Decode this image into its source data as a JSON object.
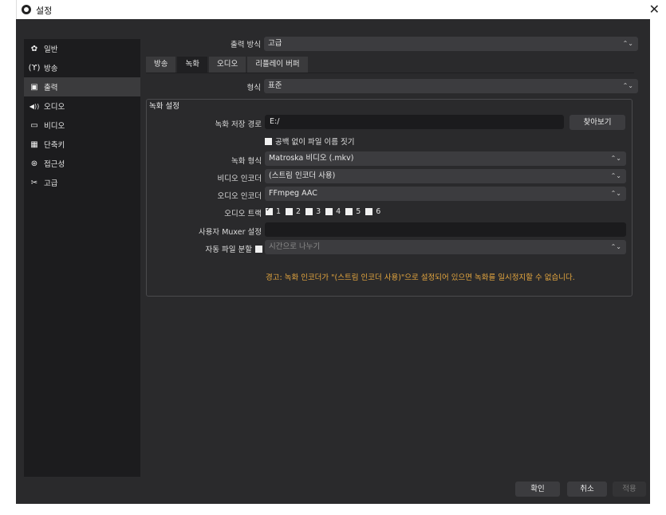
{
  "window": {
    "title": "설정",
    "close_glyph": "✕"
  },
  "sidebar": {
    "items": [
      {
        "label": "일반",
        "icon": "gear-icon",
        "glyph": "✿"
      },
      {
        "label": "방송",
        "icon": "broadcast-icon",
        "glyph": "(ϒ)"
      },
      {
        "label": "출력",
        "icon": "output-icon",
        "glyph": "▣"
      },
      {
        "label": "오디오",
        "icon": "speaker-icon",
        "glyph": "◀))"
      },
      {
        "label": "비디오",
        "icon": "monitor-icon",
        "glyph": "▭"
      },
      {
        "label": "단축키",
        "icon": "keyboard-icon",
        "glyph": "▦"
      },
      {
        "label": "접근성",
        "icon": "accessibility-icon",
        "glyph": "⊛"
      },
      {
        "label": "고급",
        "icon": "tools-icon",
        "glyph": "✂"
      }
    ],
    "active_index": 2
  },
  "output_mode": {
    "label": "출력 방식",
    "value": "고급"
  },
  "tabs": [
    "방송",
    "녹화",
    "오디오",
    "리플레이 버퍼"
  ],
  "active_tab_index": 1,
  "format": {
    "label": "형식",
    "value": "표준"
  },
  "recording": {
    "group_title": "녹화 설정",
    "path_label": "녹화 저장 경로",
    "path_value": "E:/",
    "browse_label": "찾아보기",
    "nospace_label": "공백 없이 파일 이름 짓기",
    "rec_format_label": "녹화 형식",
    "rec_format_value": "Matroska 비디오 (.mkv)",
    "video_encoder_label": "비디오 인코더",
    "video_encoder_value": "(스트림 인코더 사용)",
    "audio_encoder_label": "오디오 인코더",
    "audio_encoder_value": "FFmpeg AAC",
    "audio_track_label": "오디오 트랙",
    "tracks": [
      {
        "label": "1",
        "checked": true
      },
      {
        "label": "2",
        "checked": false
      },
      {
        "label": "3",
        "checked": false
      },
      {
        "label": "4",
        "checked": false
      },
      {
        "label": "5",
        "checked": false
      },
      {
        "label": "6",
        "checked": false
      }
    ],
    "muxer_label": "사용자 Muxer 설정",
    "muxer_value": "",
    "autosplit_label": "자동 파일 분할",
    "autosplit_value": "시간으로 나누기",
    "warning": "경고: 녹화 인코더가 \"(스트림 인코더 사용)\"으로 설정되어 있으면 녹화를 일시정지할 수 없습니다."
  },
  "footer": {
    "ok": "확인",
    "cancel": "취소",
    "apply": "적용"
  }
}
